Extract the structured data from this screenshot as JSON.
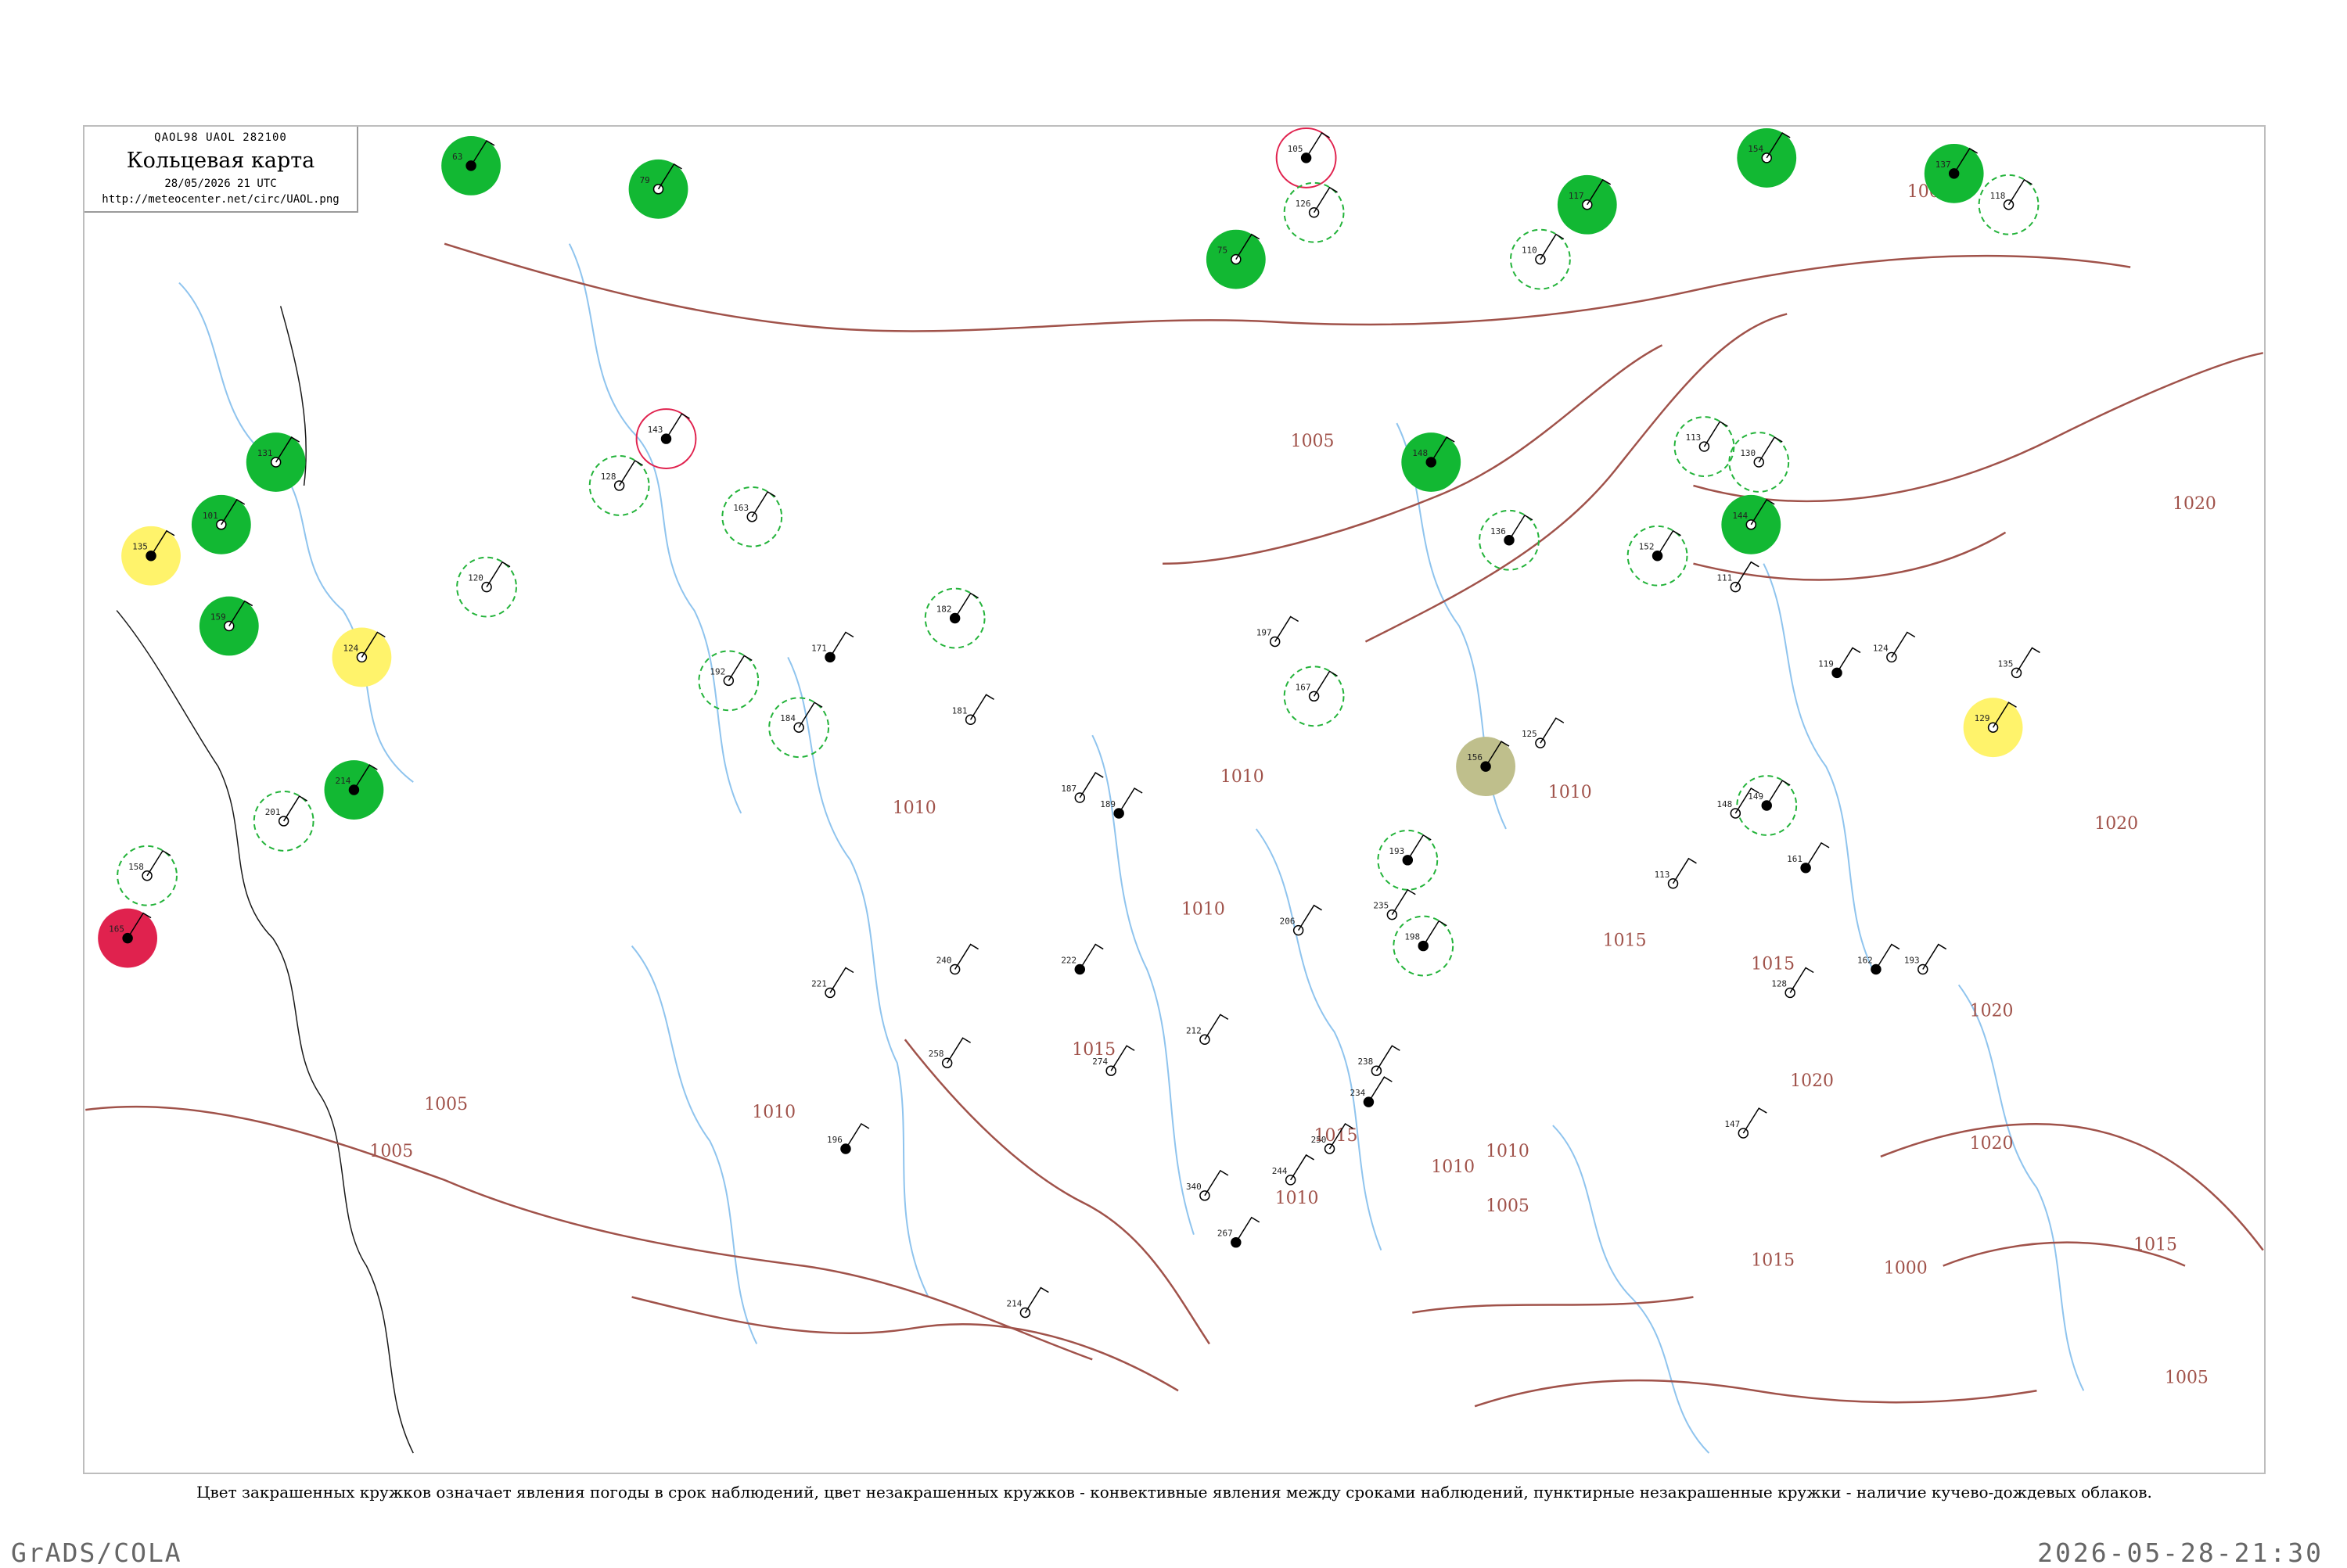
{
  "header": {
    "code": "QAOL98  UAOL  282100",
    "title": "Кольцевая карта",
    "time": "28/05/2026 21 UTC",
    "url": "http://meteocenter.net/circ/UAOL.png"
  },
  "isobars": {
    "labels": [
      "1005",
      "1005",
      "1005",
      "1005",
      "1010",
      "1010",
      "1010",
      "1010",
      "1010",
      "1010",
      "1010",
      "1015",
      "1015",
      "1015",
      "1015",
      "1015",
      "1015",
      "1020",
      "1020",
      "1020",
      "1020",
      "1020",
      "1000",
      "1005",
      "1010",
      "1005"
    ],
    "color": "#a0524a"
  },
  "stations": {
    "values": [
      "63",
      "79",
      "75",
      "105",
      "117",
      "154",
      "137",
      "118",
      "131",
      "135",
      "101",
      "159",
      "214",
      "201",
      "158",
      "165",
      "124",
      "120",
      "143",
      "163",
      "128",
      "182",
      "184",
      "167",
      "156",
      "125",
      "197",
      "193",
      "206",
      "235",
      "198",
      "221",
      "240",
      "222",
      "274",
      "258",
      "234",
      "212",
      "238",
      "196",
      "214",
      "244",
      "267",
      "250",
      "340",
      "171",
      "181",
      "187",
      "189",
      "192",
      "126",
      "148",
      "110",
      "113",
      "136",
      "130",
      "144",
      "152",
      "111",
      "124",
      "119",
      "135",
      "129",
      "149",
      "148",
      "113",
      "161",
      "128",
      "147",
      "162",
      "193"
    ],
    "filled_green": "#12b833",
    "filled_red": "#e0224e",
    "filled_yellow": "#fff36b",
    "filled_olive": "#bfbf8c",
    "ring_green": "#23b33a",
    "ring_pink": "#e0224e"
  },
  "legend_note": "Цвет закрашенных кружков означает явления погоды в срок наблюдений, цвет незакрашенных кружков - конвективные явления между сроками наблюдений, пунктирные незакрашенные кружки - наличие кучево-дождевых облаков.",
  "footer": {
    "left": "GrADS/COLA",
    "right": "2026-05-28-21:30"
  }
}
